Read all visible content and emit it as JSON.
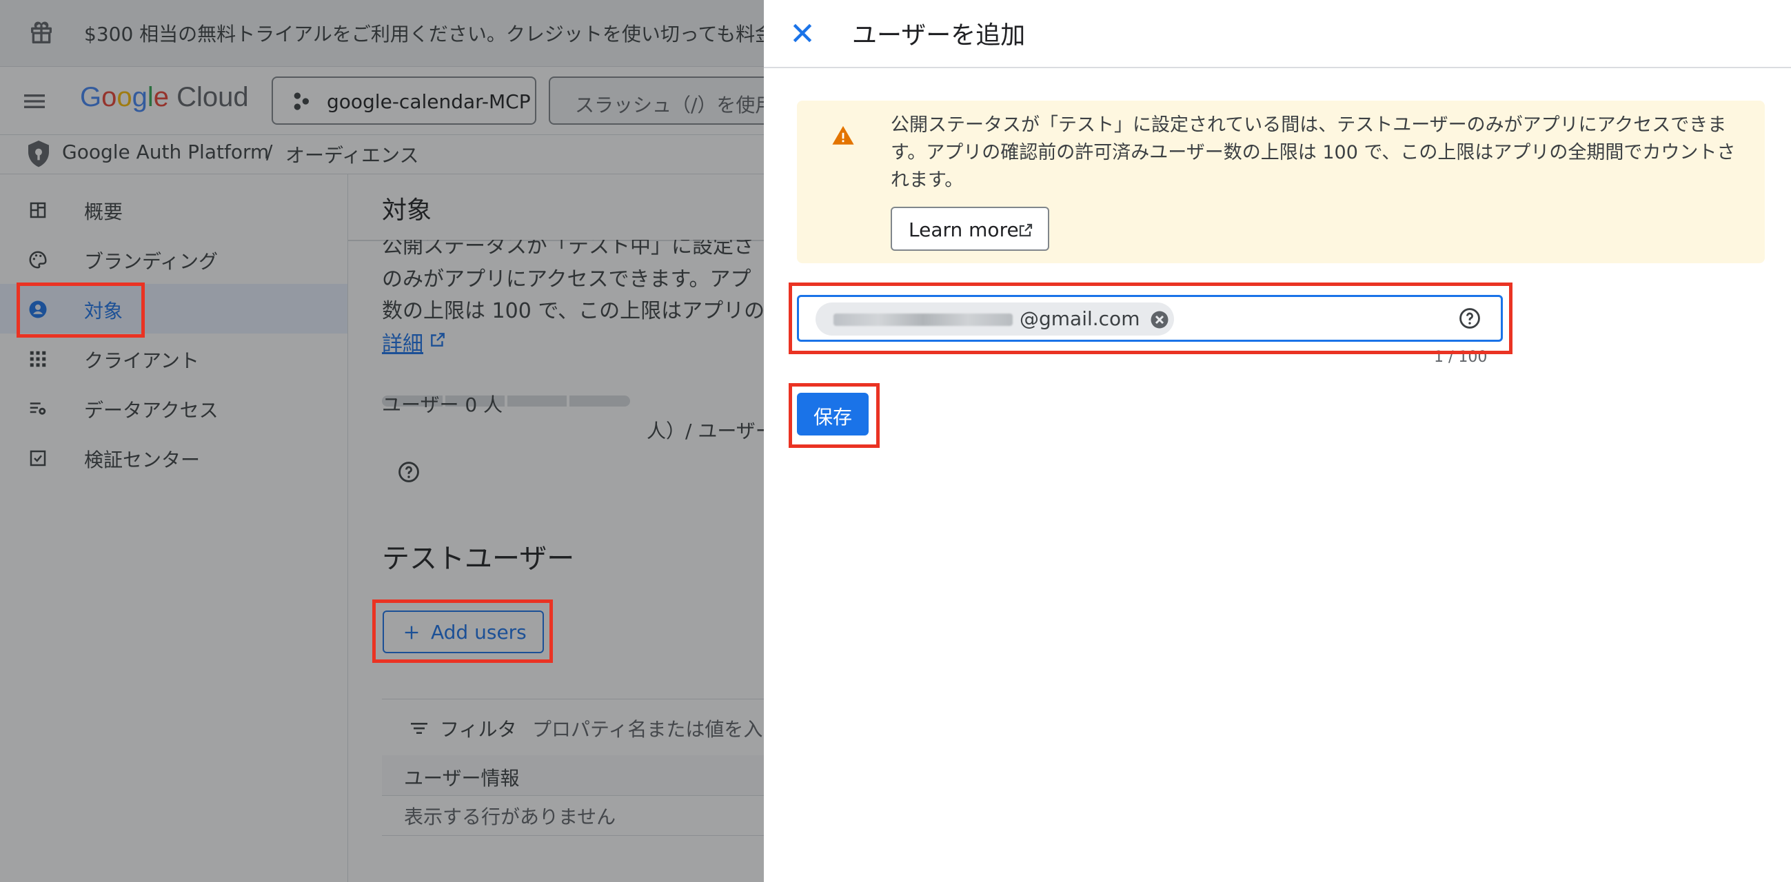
{
  "banner": {
    "text": "$300 相当の無料トライアルをご利用ください。クレジットを使い切っても料金"
  },
  "header": {
    "logo": "Google Cloud",
    "project": "google-calendar-MCP",
    "search_placeholder": "スラッシュ（/）を使用"
  },
  "breadcrumb": {
    "product": "Google Auth Platform",
    "separator": "/",
    "current": "オーディエンス"
  },
  "sidebar": {
    "items": [
      {
        "label": "概要",
        "icon": "dashboard-icon"
      },
      {
        "label": "ブランディング",
        "icon": "palette-icon"
      },
      {
        "label": "対象",
        "icon": "person-icon",
        "active": true
      },
      {
        "label": "クライアント",
        "icon": "grid-icon"
      },
      {
        "label": "データアクセス",
        "icon": "settings-list-icon"
      },
      {
        "label": "検証センター",
        "icon": "checkbox-icon"
      }
    ]
  },
  "main": {
    "title": "対象",
    "line1": "公開ステータスが「テスト中」に設定さ",
    "line2": "のみがアプリにアクセスできます。アプ",
    "line3": "数の上限は 100 で、この上限はアプリの",
    "detail_link": "詳細",
    "user_count_line1": "ユーザー 0 人",
    "user_count_line2": "人）/ ユーザー",
    "test_users_title": "テストユーザー",
    "add_users": "Add users",
    "filter_label": "フィルタ",
    "filter_placeholder": "プロパティ名または値を入",
    "table_header": "ユーザー情報",
    "table_empty": "表示する行がありません"
  },
  "panel": {
    "title": "ユーザーを追加",
    "warning": "公開ステータスが「テスト」に設定されている間は、テストユーザーのみがアプリにアクセスできます。アプリの確認前の許可済みユーザー数の上限は 100 で、この上限はアプリの全期間でカウントされます。",
    "learn_more": "Learn more",
    "email_chip": "@gmail.com",
    "counter": "1 / 100",
    "save": "保存"
  },
  "colors": {
    "accent": "#1a73e8",
    "warning_bg": "#fef7e0",
    "warning_icon": "#e37400",
    "highlight": "#ea3323"
  }
}
